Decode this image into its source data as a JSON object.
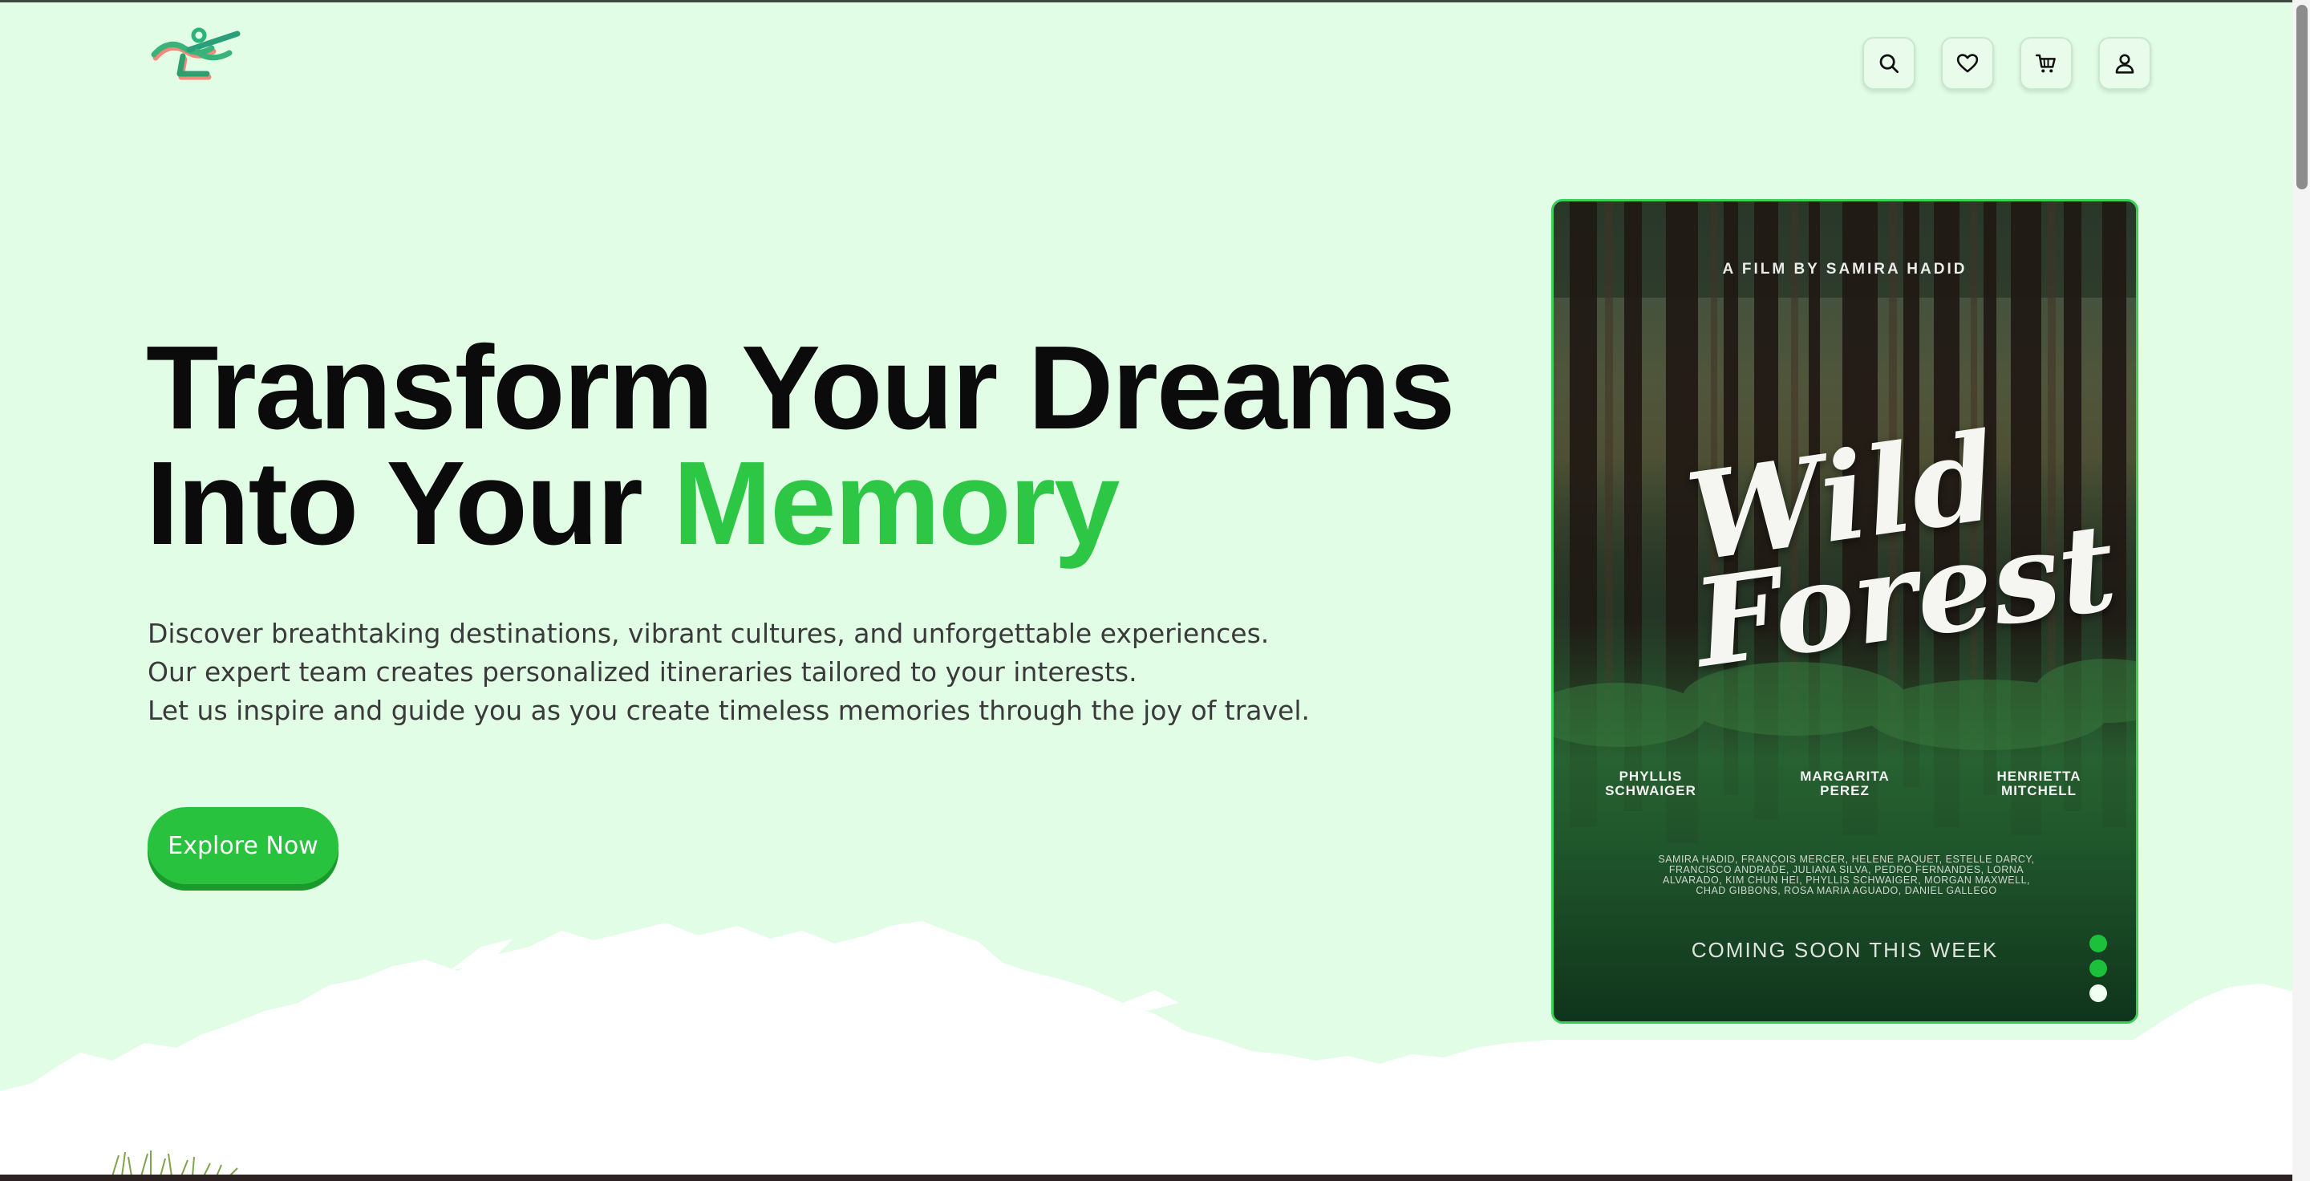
{
  "header": {
    "logo_icon": "runner-logo-icon",
    "icons": [
      "search-icon",
      "heart-icon",
      "cart-icon",
      "user-icon"
    ]
  },
  "hero": {
    "title_line1": "Transform Your Dreams",
    "title_line2_prefix": "Into Your ",
    "title_line2_accent": "Memory",
    "description": [
      "Discover breathtaking destinations, vibrant cultures, and unforgettable experiences.",
      "Our expert team creates personalized itineraries tailored to your interests.",
      "Let us inspire and guide you as you create timeless memories through the joy of travel."
    ],
    "cta_label": "Explore Now"
  },
  "poster": {
    "credit": "A FILM BY SAMIRA HADID",
    "title_line1": "Wild",
    "title_line2": "Forest",
    "cast": [
      {
        "first": "PHYLLIS",
        "last": "SCHWAIGER"
      },
      {
        "first": "MARGARITA",
        "last": "PEREZ"
      },
      {
        "first": "HENRIETTA",
        "last": "MITCHELL"
      }
    ],
    "crew": [
      "SAMIRA HADID, FRANÇOIS MERCER, HELENE PAQUET, ESTELLE DARCY,",
      "FRANCISCO ANDRADE, JULIANA SILVA, PEDRO FERNANDES, LORNA",
      "ALVARADO, KIM CHUN HEI, PHYLLIS SCHWAIGER, MORGAN MAXWELL,",
      "CHAD GIBBONS, ROSA MARIA AGUADO, DANIEL GALLEGO"
    ],
    "tagline": "COMING SOON THIS WEEK"
  },
  "slider": {
    "slide_count": 3,
    "active_index": 2
  },
  "colors": {
    "background": "#e2fde6",
    "accent": "#2ec745",
    "button": "#29c23e",
    "poster_border": "#3ecf55"
  }
}
